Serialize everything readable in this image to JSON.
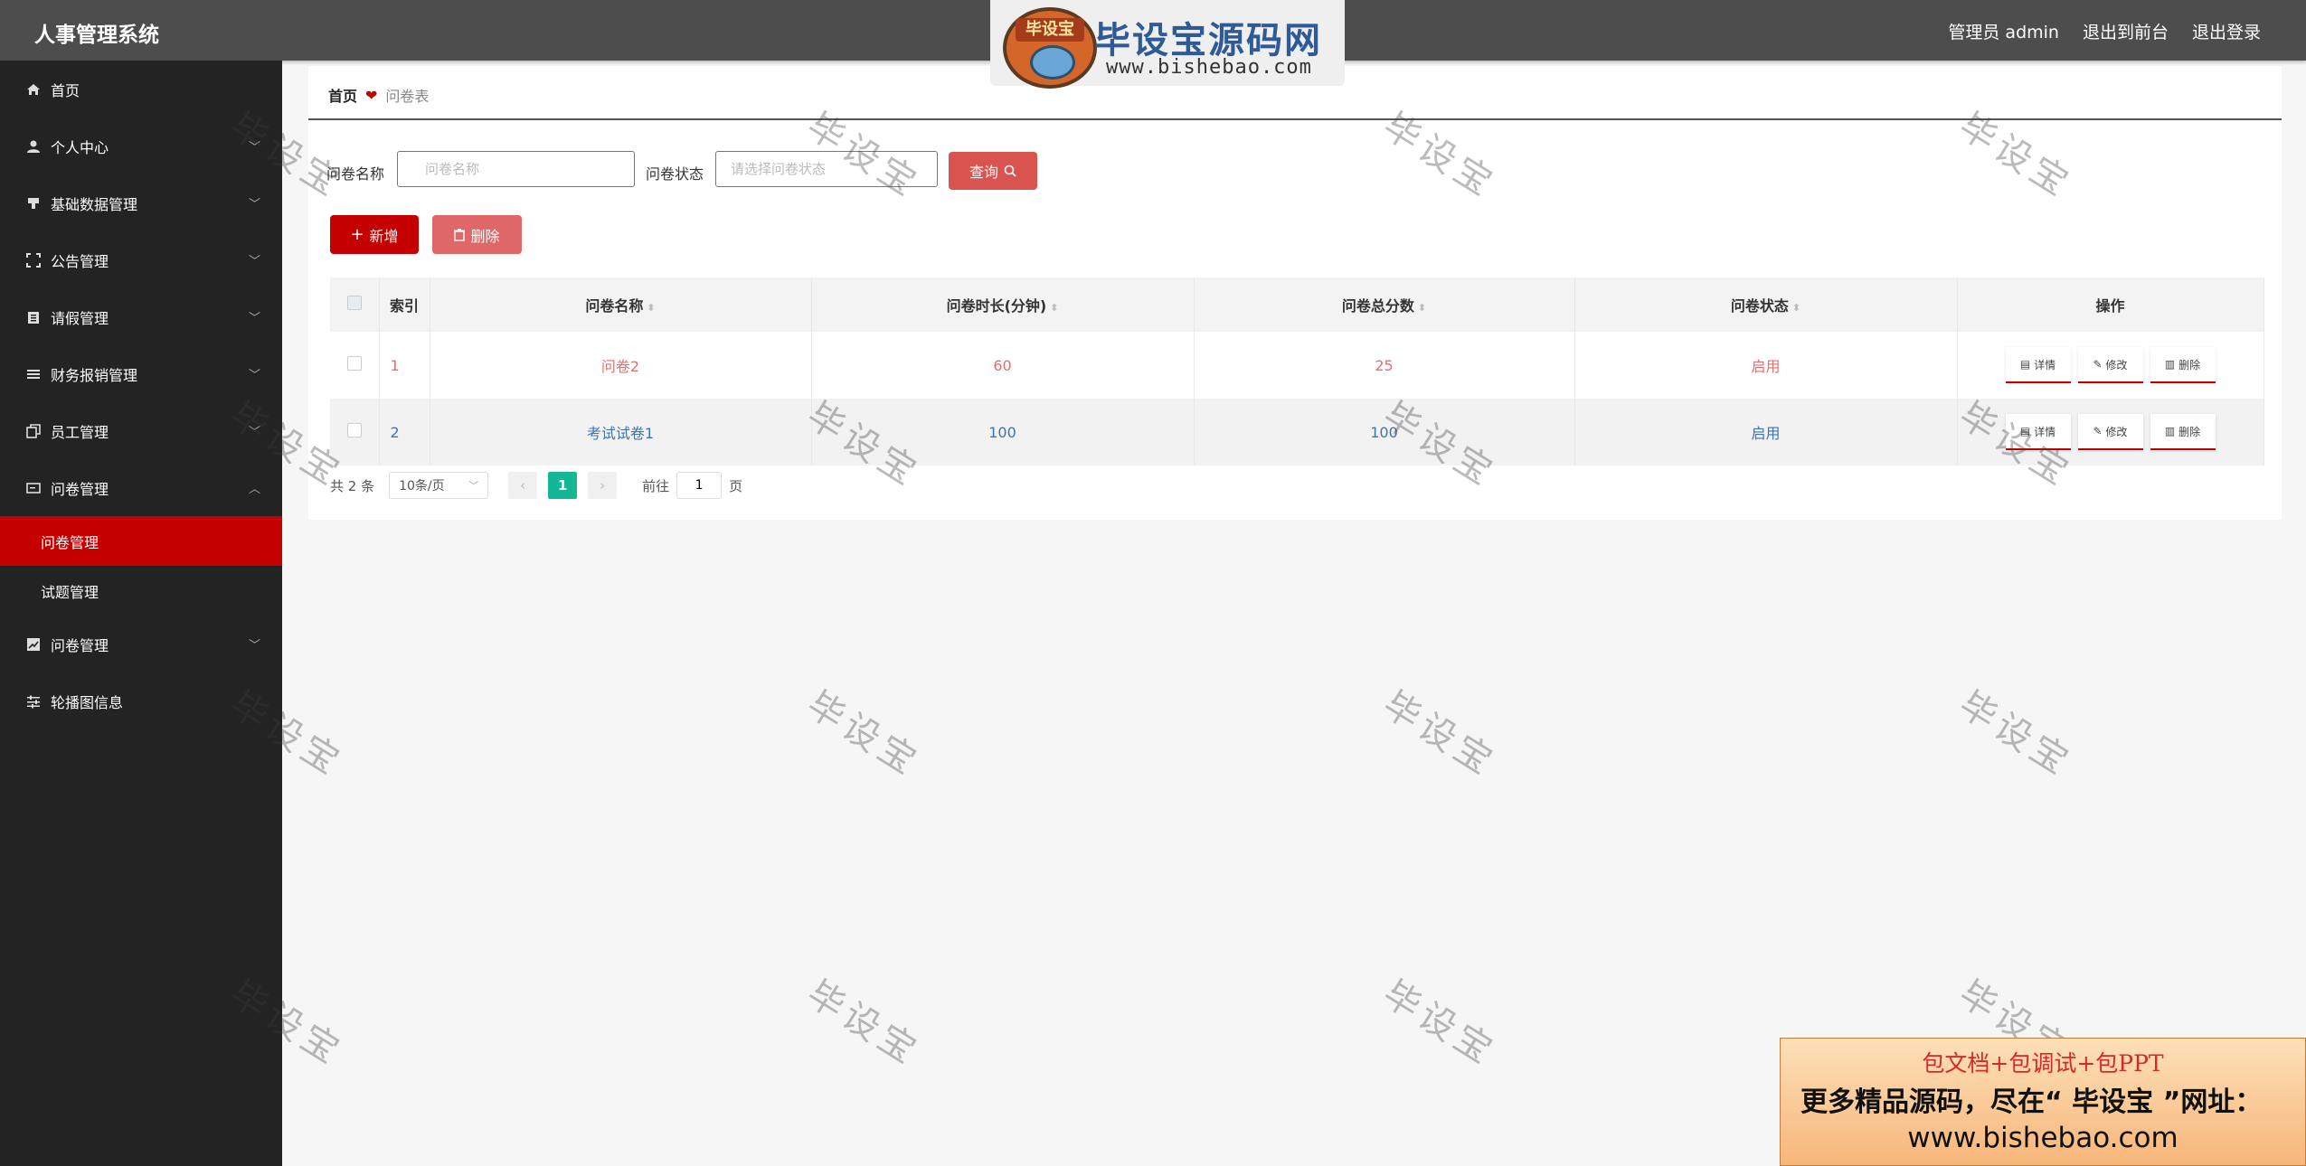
{
  "header": {
    "app_title": "人事管理系统",
    "links": [
      "管理员 admin",
      "退出到前台",
      "退出登录"
    ]
  },
  "watermark_logo": {
    "badge": "毕设宝",
    "name": "毕设宝源码网",
    "url": "www.bishebao.com"
  },
  "sidebar": {
    "items": [
      {
        "label": "首页",
        "icon": "home-icon"
      },
      {
        "label": "个人中心",
        "icon": "user-icon",
        "expandable": true
      },
      {
        "label": "基础数据管理",
        "icon": "stamp-icon",
        "expandable": true
      },
      {
        "label": "公告管理",
        "icon": "frame-icon",
        "expandable": true
      },
      {
        "label": "请假管理",
        "icon": "clipboard-icon",
        "expandable": true
      },
      {
        "label": "财务报销管理",
        "icon": "list-icon",
        "expandable": true
      },
      {
        "label": "员工管理",
        "icon": "copy-icon",
        "expandable": true
      },
      {
        "label": "问卷管理",
        "icon": "card-icon",
        "expandable": true,
        "expanded": true,
        "children": [
          {
            "label": "问卷管理",
            "active": true
          },
          {
            "label": "试题管理",
            "active": false
          }
        ]
      },
      {
        "label": "问卷管理",
        "icon": "chart-icon",
        "expandable": true
      },
      {
        "label": "轮播图信息",
        "icon": "sliders-icon",
        "expandable": false
      }
    ]
  },
  "breadcrumb": {
    "home": "首页",
    "current": "问卷表"
  },
  "search": {
    "name_label": "问卷名称",
    "name_placeholder": "问卷名称",
    "status_label": "问卷状态",
    "status_placeholder": "请选择问卷状态",
    "query_button": "查询"
  },
  "actions": {
    "add": "新增",
    "delete": "删除"
  },
  "table": {
    "columns": [
      "索引",
      "问卷名称",
      "问卷时长(分钟)",
      "问卷总分数",
      "问卷状态",
      "操作"
    ],
    "rows": [
      {
        "index": "1",
        "name": "问卷2",
        "duration": "60",
        "score": "25",
        "status": "启用"
      },
      {
        "index": "2",
        "name": "考试试卷1",
        "duration": "100",
        "score": "100",
        "status": "启用"
      }
    ],
    "row_actions": {
      "detail": "详情",
      "edit": "修改",
      "delete": "删除"
    }
  },
  "pagination": {
    "total": "共 2 条",
    "page_size": "10条/页",
    "current_page": "1",
    "goto_prefix": "前往",
    "goto_value": "1",
    "goto_suffix": "页"
  },
  "watermark_text": "毕设宝",
  "ad": {
    "line1": "包文档+包调试+包PPT",
    "line2": "更多精品源码，尽在“ 毕设宝 ”网址：",
    "line3": "www.bishebao.com"
  },
  "colors": {
    "topbar": "#4d4d4d",
    "sidebar": "#232323",
    "accent": "#c40000",
    "pager_active": "#13b795"
  }
}
